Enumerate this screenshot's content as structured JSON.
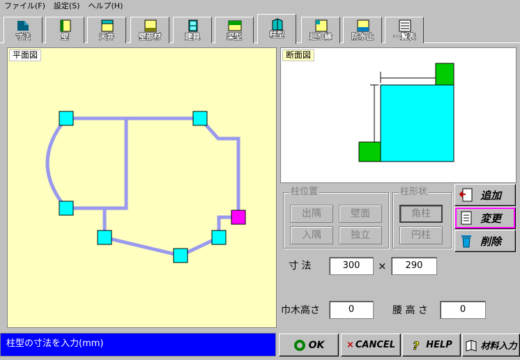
{
  "menu": [
    "ファイル(F)",
    "設定(S)",
    "ヘルプ(H)"
  ],
  "tabs": [
    {
      "label": "寸法",
      "icon": "dimension-icon"
    },
    {
      "label": "壁",
      "icon": "wall-icon"
    },
    {
      "label": "天井",
      "icon": "ceiling-icon"
    },
    {
      "label": "壁部材",
      "icon": "wall-member-icon"
    },
    {
      "label": "建具",
      "icon": "fitting-icon"
    },
    {
      "label": "梁型",
      "icon": "beam-icon"
    },
    {
      "label": "柱型",
      "icon": "column-icon",
      "active": true
    },
    {
      "label": "廻り縁",
      "icon": "crown-molding-icon"
    },
    {
      "label": "防水止",
      "icon": "waterproof-icon"
    },
    {
      "label": "一覧表",
      "icon": "list-icon"
    }
  ],
  "plan": {
    "caption": "平面図"
  },
  "section": {
    "caption": "断面図"
  },
  "column_position": {
    "title": "柱位置",
    "buttons": [
      "出隅",
      "壁面",
      "入隅",
      "独立"
    ]
  },
  "column_shape": {
    "title": "柱形状",
    "buttons": [
      "角柱",
      "円柱"
    ],
    "selected": "角柱"
  },
  "actions": {
    "add": "追加",
    "change": "変更",
    "delete": "削除"
  },
  "dimension": {
    "label": "寸 法",
    "x": "300",
    "times": "×",
    "y": "290"
  },
  "baseboard": {
    "label": "巾木高さ",
    "value": "0"
  },
  "wainscot": {
    "label": "腰 高 さ",
    "value": "0"
  },
  "status": {
    "message": "柱型の寸法を入力(mm)"
  },
  "buttons": {
    "ok": "OK",
    "cancel": "CANCEL",
    "help": "HELP",
    "material": "材料入力"
  },
  "colors": {
    "plan_bg": "#ffffc0",
    "wall_line": "#9999ee",
    "node": "#00ffff",
    "selected_node": "#ff00ff",
    "section_column": "#00ffff",
    "section_block": "#00cc00",
    "status_bg": "#0000ff"
  }
}
